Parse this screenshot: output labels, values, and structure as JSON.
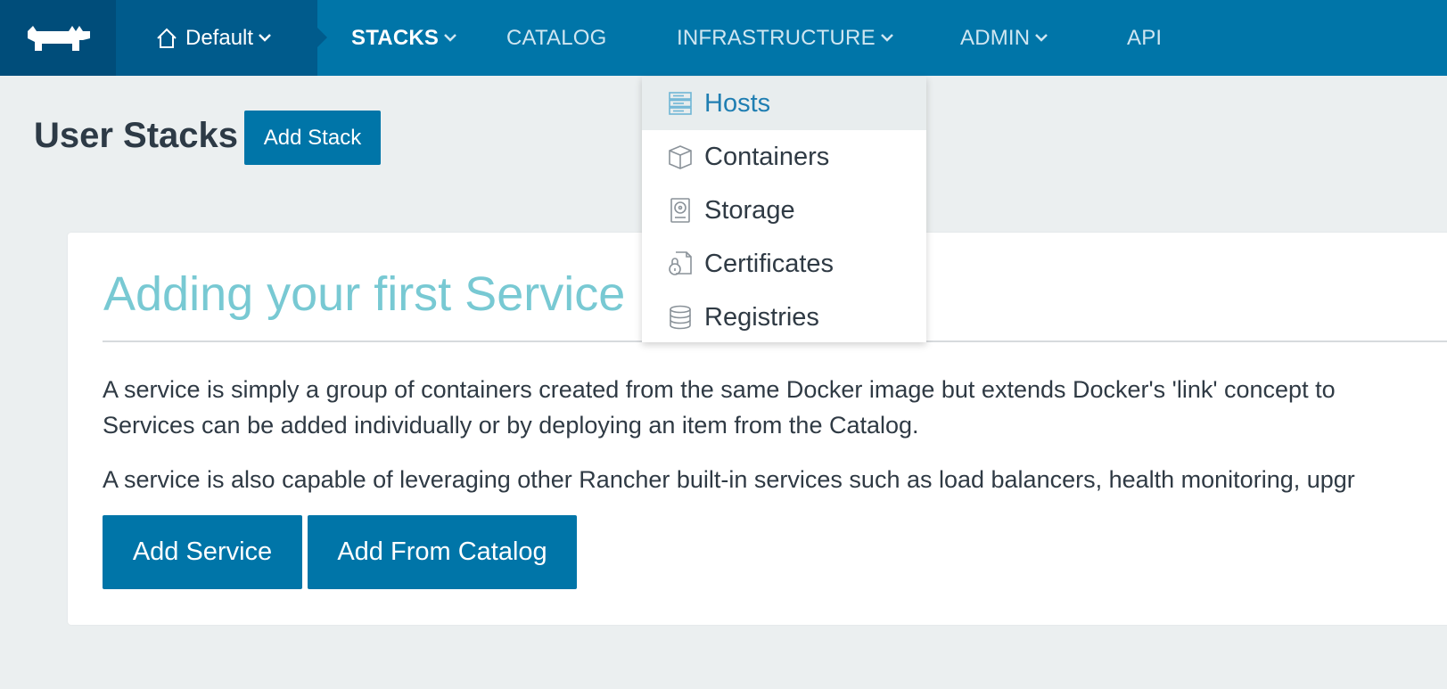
{
  "nav": {
    "environment": "Default",
    "items": [
      {
        "label": "STACKS",
        "active": true,
        "dropdown": true
      },
      {
        "label": "CATALOG",
        "active": false,
        "dropdown": false
      },
      {
        "label": "INFRASTRUCTURE",
        "active": false,
        "dropdown": true
      },
      {
        "label": "ADMIN",
        "active": false,
        "dropdown": true
      },
      {
        "label": "API",
        "active": false,
        "dropdown": false
      }
    ]
  },
  "page": {
    "title": "User Stacks",
    "add_stack_label": "Add Stack"
  },
  "card": {
    "title": "Adding your first Service",
    "p1_line1": "A service is simply a group of containers created from the same Docker image but extends Docker's 'link' concept to",
    "p1_line2": "Services can be added individually or by deploying an item from the Catalog.",
    "p2": "A service is also capable of leveraging other Rancher built-in services such as load balancers, health monitoring, upgr",
    "add_service_label": "Add Service",
    "add_catalog_label": "Add From Catalog"
  },
  "dropdown": {
    "items": [
      {
        "label": "Hosts",
        "icon": "hosts-icon",
        "selected": true
      },
      {
        "label": "Containers",
        "icon": "container-icon",
        "selected": false
      },
      {
        "label": "Storage",
        "icon": "storage-icon",
        "selected": false
      },
      {
        "label": "Certificates",
        "icon": "certificate-icon",
        "selected": false
      },
      {
        "label": "Registries",
        "icon": "registry-icon",
        "selected": false
      }
    ]
  },
  "colors": {
    "nav_bg": "#0075a8",
    "logo_bg": "#004d7a",
    "env_bg": "#005b8c",
    "accent": "#0075a8",
    "card_title": "#78c9d3",
    "page_bg": "#ebeff0"
  }
}
